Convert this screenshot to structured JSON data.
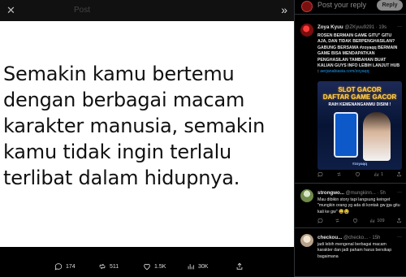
{
  "viewer": {
    "top_ghost_label": "Post",
    "quote": "Semakin kamu bertemu dengan berbagai macam karakter manusia, semakin kamu tidak ingin terlalu terlibat dalam hidupnya.",
    "actions": {
      "reply_count": "174",
      "retweet_count": "511",
      "like_count": "1.5K",
      "views_count": "30K"
    }
  },
  "panel": {
    "placeholder": "Post your reply",
    "reply_button": "Reply",
    "tweets": [
      {
        "name": "Zoya Kyuu",
        "handle": "@ZKyuu9291",
        "time": "· 19s",
        "text": "ROSEN BERMAIN GAME GITU\" GITU AJA, DAN TIDAK BERPENGHASILAN? GABUNG BERSAMA #zoyaqq BERMAIN GAME BISA MENDAPATKAN PENGHASILAN TAMBAHAN BUAT KALIAN GUYS INFO LEBIH LANJUT HUB :",
        "link": "aerjanabiasia.com/zoyaqq",
        "promo": {
          "title": "SLOT GACOR\nDAFTAR GAME GACOR",
          "sub": "RAIH KEMENANGANMU DISINI !",
          "foot": "#zoyaqq"
        },
        "stats": {
          "views": "1"
        }
      },
      {
        "name": "strongwo...",
        "handle": "@mungkinn...",
        "time": "· 5h",
        "text": "Mau dibikin story tapi langsung keinget \"mungkin orang yg ada di kontak gw jga gitu kali ke gw\" 😅😭",
        "stats": {
          "views": "109"
        }
      },
      {
        "name": "checkou...",
        "handle": "@checko...",
        "time": "· 15h",
        "text": "jadi lebih mengenal berbagai macam karakter dan jadi paham harus bersikap bagaimana"
      }
    ]
  },
  "icons": {
    "close": "close-icon",
    "expand": "double-chevron-right-icon"
  }
}
